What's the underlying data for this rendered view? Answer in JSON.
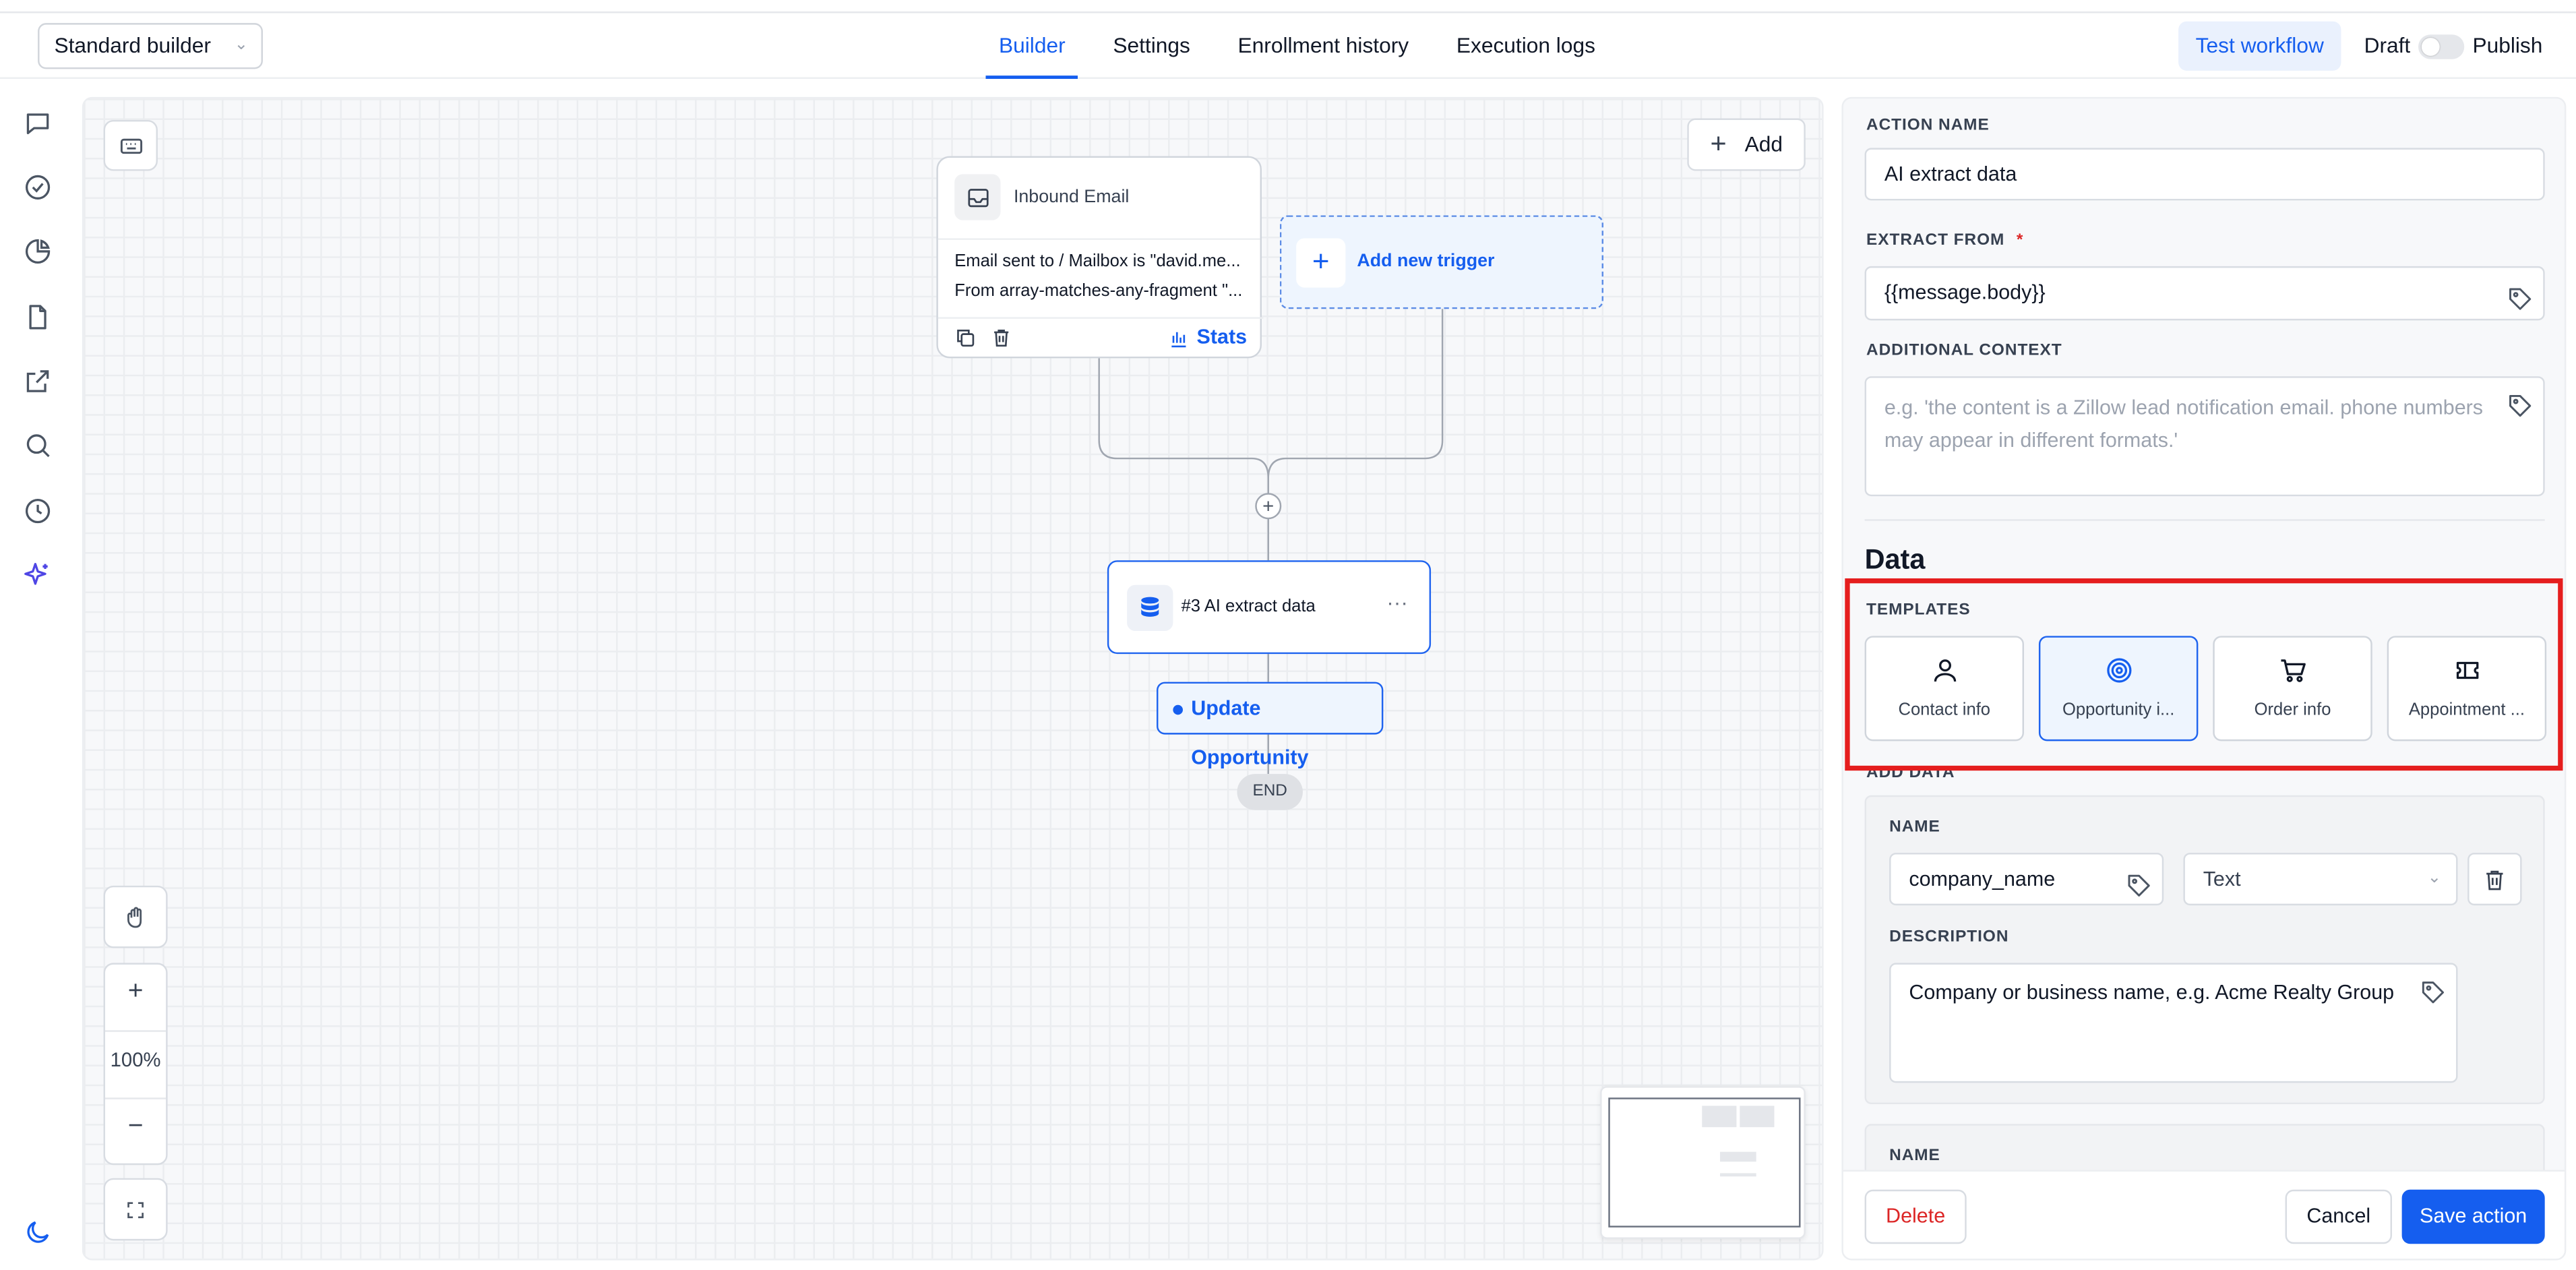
{
  "header": {
    "builder_select": "Standard builder",
    "tabs": [
      {
        "label": "Builder",
        "active": true
      },
      {
        "label": "Settings",
        "active": false
      },
      {
        "label": "Enrollment history",
        "active": false
      },
      {
        "label": "Execution logs",
        "active": false
      }
    ],
    "test_workflow": "Test workflow",
    "draft_label": "Draft",
    "publish_label": "Publish",
    "publish_on": false
  },
  "rail": {
    "icons": [
      "chat-icon",
      "check-circle-icon",
      "pie-chart-icon",
      "file-icon",
      "external-link-icon",
      "search-icon",
      "history-icon",
      "sparkles-icon"
    ],
    "bottom_icon": "moon-icon"
  },
  "canvas": {
    "add_label": "Add",
    "trigger": {
      "title": "Inbound Email",
      "line1": "Email sent to / Mailbox is \"david.me...",
      "line2": "From array-matches-any-fragment \"...",
      "stats_label": "Stats"
    },
    "add_trigger_label": "Add new trigger",
    "action_label": "#3 AI extract data",
    "action_more": "···",
    "update_label": "Update Opportunity",
    "end_label": "END",
    "zoom_level": "100%"
  },
  "panel": {
    "action_name_label": "ACTION NAME",
    "action_name_value": "AI extract data",
    "extract_from_label": "EXTRACT FROM",
    "required_mark": "*",
    "extract_from_value": "{{message.body}}",
    "additional_context_label": "ADDITIONAL CONTEXT",
    "additional_context_placeholder": "e.g. 'the content is a Zillow lead notification email. phone numbers may appear in different formats.'",
    "data_heading": "Data",
    "templates_label": "TEMPLATES",
    "templates": [
      {
        "label": "Contact info",
        "icon": "user-icon",
        "selected": false
      },
      {
        "label": "Opportunity i...",
        "icon": "target-icon",
        "selected": true
      },
      {
        "label": "Order info",
        "icon": "cart-icon",
        "selected": false
      },
      {
        "label": "Appointment ...",
        "icon": "ticket-icon",
        "selected": false
      }
    ],
    "add_data_label": "ADD DATA",
    "field1": {
      "name_label": "NAME",
      "name_value": "company_name",
      "type_value": "Text",
      "description_label": "DESCRIPTION",
      "description_value": "Company or business name, e.g. Acme Realty Group"
    },
    "field2_name_label": "NAME",
    "delete_label": "Delete",
    "cancel_label": "Cancel",
    "save_label": "Save action"
  },
  "colors": {
    "accent": "#155eef",
    "danger": "#dc2626",
    "highlight": "#e51e1e"
  }
}
